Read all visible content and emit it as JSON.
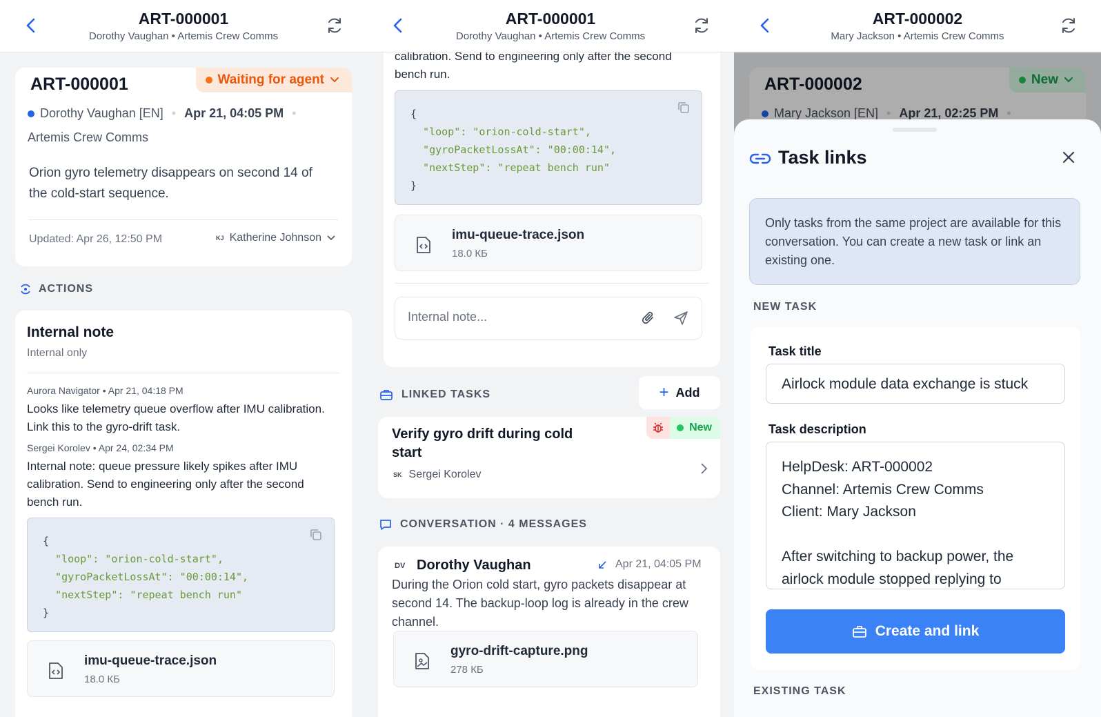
{
  "p1": {
    "header": {
      "title": "ART-000001",
      "subtitle": "Dorothy Vaughan • Artemis Crew Comms"
    },
    "ticket": {
      "id": "ART-000001",
      "status": "Waiting for agent",
      "status_color": "#f97316",
      "client": "Dorothy Vaughan [EN]",
      "date": "Apr 21, 04:05 PM",
      "channel": "Artemis Crew Comms",
      "summary": "Orion gyro telemetry disappears on second 14 of the cold-start sequence.",
      "updated": "Updated: Apr 26, 12:50 PM",
      "assignee_initials": "KJ",
      "assignee": "Katherine Johnson"
    },
    "actions_label": "ACTIONS",
    "note": {
      "title": "Internal note",
      "subtitle": "Internal only",
      "msgs": [
        {
          "meta": "Aurora Navigator • Apr 21, 04:18 PM",
          "text": "Looks like telemetry queue overflow after IMU calibration. Link this to the gyro-drift task."
        },
        {
          "meta": "Sergei Korolev • Apr 24, 02:34 PM",
          "text": "Internal note: queue pressure likely spikes after IMU calibration. Send to engineering only after the second bench run."
        }
      ]
    },
    "code": [
      "{",
      "  \"loop\": \"orion-cold-start\",",
      "  \"gyroPacketLossAt\": \"00:00:14\",",
      "  \"nextStep\": \"repeat bench run\"",
      "}"
    ],
    "file": {
      "name": "imu-queue-trace.json",
      "size": "18.0 КБ"
    }
  },
  "p2": {
    "header": {
      "title": "ART-000001",
      "subtitle": "Dorothy Vaughan • Artemis Crew Comms"
    },
    "top_text_1": "calibration. Send to engineering only after the second",
    "top_text_2": "bench run.",
    "code": [
      "{",
      "  \"loop\": \"orion-cold-start\",",
      "  \"gyroPacketLossAt\": \"00:00:14\",",
      "  \"nextStep\": \"repeat bench run\"",
      "}"
    ],
    "file": {
      "name": "imu-queue-trace.json",
      "size": "18.0 КБ"
    },
    "note_placeholder": "Internal note...",
    "linked_label": "LINKED TASKS",
    "add_label": "Add",
    "task": {
      "title": "Verify gyro drift during cold start",
      "status": "New",
      "assignee_initials": "SK",
      "assignee": "Sergei Korolev"
    },
    "conv_label": "CONVERSATION · 4 MESSAGES",
    "message": {
      "initials": "DV",
      "author": "Dorothy Vaughan",
      "date": "Apr 21, 04:05 PM",
      "text": "During the Orion cold start, gyro packets disappear at second 14. The backup-loop log is already in the crew channel."
    },
    "file2": {
      "name": "gyro-drift-capture.png",
      "size": "278 КБ"
    }
  },
  "p3": {
    "header": {
      "title": "ART-000002",
      "subtitle": "Mary Jackson • Artemis Crew Comms"
    },
    "bg_ticket": {
      "id": "ART-000002",
      "status": "New",
      "client": "Mary Jackson [EN]",
      "date": "Apr 21, 02:25 PM"
    },
    "sheet": {
      "title": "Task links",
      "info": "Only tasks from the same project are available for this conversation. You can create a new task or link an existing one.",
      "new_task_label": "NEW TASK",
      "task_title_label": "Task title",
      "task_title_value": "Airlock module data exchange is stuck",
      "task_desc_label": "Task description",
      "desc_lines": [
        "HelpDesk: ART-000002",
        "Channel: Artemis Crew Comms",
        "Client: Mary Jackson",
        "",
        "After switching to backup power, the",
        "airlock module stopped replying to"
      ],
      "create_button": "Create and link",
      "existing_label": "EXISTING TASK"
    }
  },
  "colors": {
    "accent": "#2563eb",
    "green": "#22c55e",
    "orange": "#f97316"
  }
}
